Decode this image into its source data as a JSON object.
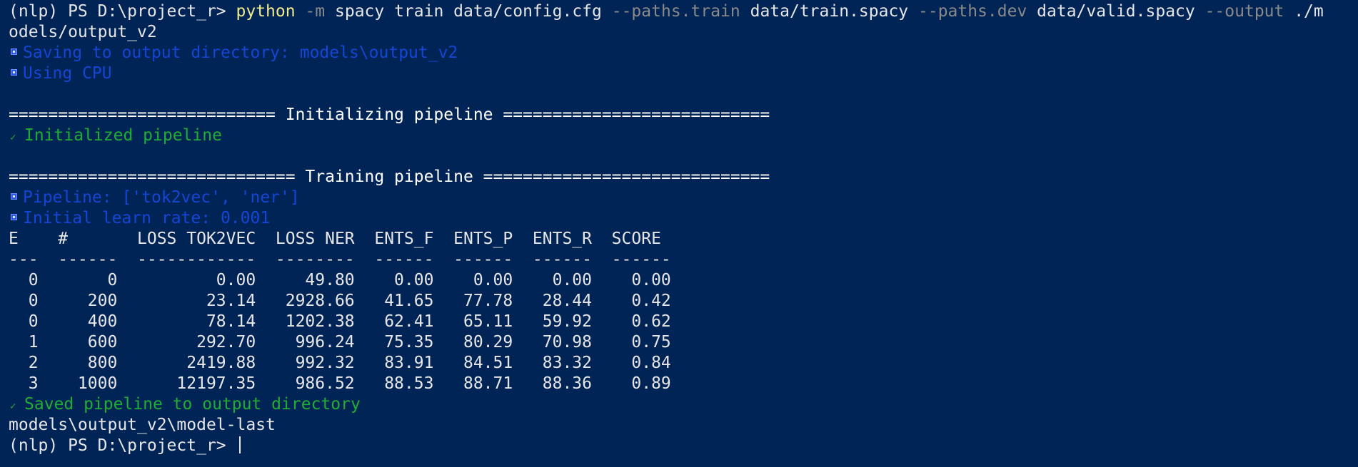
{
  "terminal": {
    "prompt_line": {
      "prompt": "(nlp) PS D:\\project_r> ",
      "python": "python",
      "flag_m": "-m",
      "module_train": " spacy train data/config.cfg ",
      "flag_train": "--paths.train",
      "train_value": " data/train.spacy ",
      "flag_dev": "--paths.dev",
      "dev_value": " data/valid.spacy ",
      "flag_output": "--output",
      "output_value": " ./m",
      "wrapped": "odels/output_v2"
    },
    "info1": "Saving to output directory: models\\output_v2",
    "info2": "Using CPU",
    "init_header": "=========================== Initializing pipeline ===========================",
    "init_done": "Initialized pipeline",
    "train_header": "============================= Training pipeline =============================",
    "info3": "Pipeline: ['tok2vec', 'ner']",
    "info4": "Initial learn rate: 0.001",
    "table_header": "E    #       LOSS TOK2VEC  LOSS NER  ENTS_F  ENTS_P  ENTS_R  SCORE ",
    "table_rule": "---  ------  ------------  --------  ------  ------  ------  ------",
    "rows": [
      "  0       0          0.00     49.80    0.00    0.00    0.00    0.00",
      "  0     200         23.14   2928.66   41.65   77.78   28.44    0.42",
      "  0     400         78.14   1202.38   62.41   65.11   59.92    0.62",
      "  1     600        292.70    996.24   75.35   80.29   70.98    0.75",
      "  2     800       2419.88    992.32   83.91   84.51   83.32    0.84",
      "  3    1000      12197.35    986.52   88.53   88.71   88.36    0.89"
    ],
    "saved": "Saved pipeline to output directory",
    "saved_path": "models\\output_v2\\model-last",
    "final_prompt": "(nlp) PS D:\\project_r> ",
    "check_glyph": "✓"
  },
  "colors": {
    "background": "#012456",
    "text": "#e6e6e6",
    "python": "#f0ea8c",
    "flag": "#8a8a8a",
    "info": "#1446d6",
    "success": "#1fae33"
  }
}
